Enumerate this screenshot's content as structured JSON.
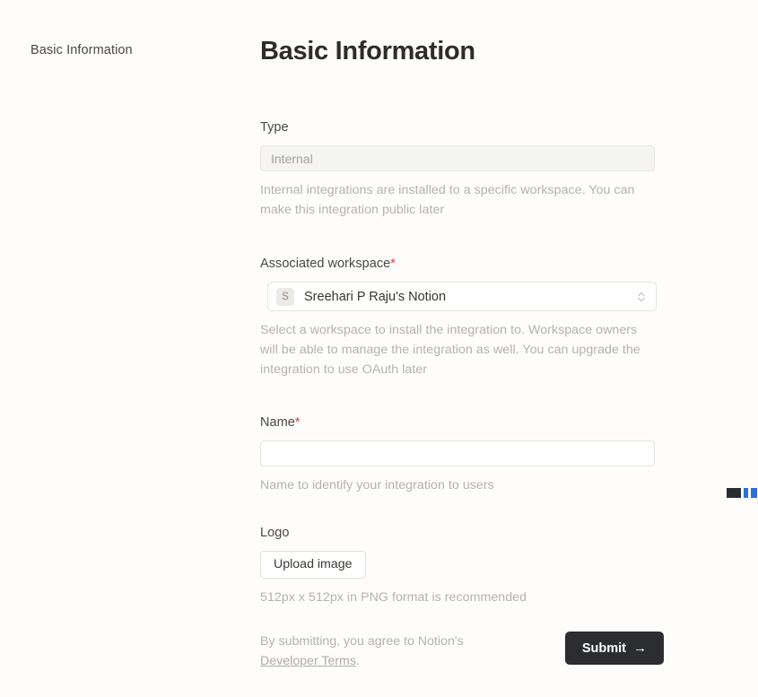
{
  "sidebar": {
    "items": [
      {
        "label": "Basic Information"
      }
    ]
  },
  "main": {
    "title": "Basic Information",
    "fields": {
      "type": {
        "label": "Type",
        "value": "Internal",
        "helper": "Internal integrations are installed to a specific workspace. You can make this integration public later"
      },
      "workspace": {
        "label": "Associated workspace",
        "required_marker": "*",
        "avatar_initial": "S",
        "value": "Sreehari P Raju's Notion",
        "helper": "Select a workspace to install the integration to. Workspace owners will be able to manage the integration as well. You can upgrade the integration to use OAuth later"
      },
      "name": {
        "label": "Name",
        "required_marker": "*",
        "value": "",
        "placeholder": "",
        "helper": "Name to identify your integration to users"
      },
      "logo": {
        "label": "Logo",
        "upload_label": "Upload image",
        "helper": "512px x 512px in PNG format is recommended"
      }
    }
  },
  "footer": {
    "terms_prefix": "By submitting, you agree to Notion's ",
    "terms_link": "Developer Terms",
    "terms_suffix": ".",
    "submit_label": "Submit",
    "submit_arrow": "→"
  },
  "colors": {
    "background": "#fefdfb",
    "text": "#37352f",
    "muted": "#b6b2ad",
    "required": "#e03e3e",
    "submit_bg": "#2b2d31",
    "edge_dark": "#2a2d30",
    "edge_blue": "#2b6ee0"
  }
}
